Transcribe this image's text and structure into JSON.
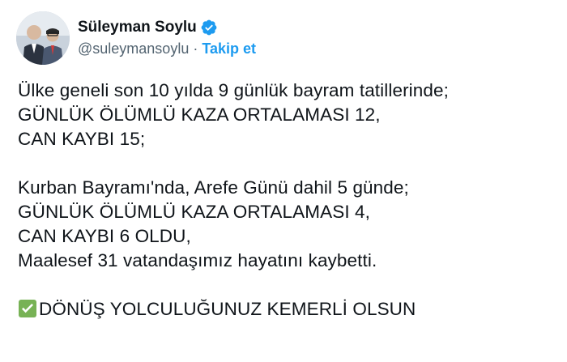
{
  "tweet": {
    "author": {
      "display_name": "Süleyman Soylu",
      "handle": "@suleymansoylu",
      "separator": "·",
      "follow_label": "Takip et",
      "verified": true,
      "verified_color": "#1d9bf0"
    },
    "lines": [
      "Ülke geneli son 10 yılda 9 günlük bayram tatillerinde;",
      "GÜNLÜK ÖLÜMLÜ KAZA ORTALAMASI 12,",
      "CAN KAYBI 15;",
      "",
      "Kurban Bayramı'nda, Arefe Günü dahil 5 günde;",
      "GÜNLÜK ÖLÜMLÜ KAZA ORTALAMASI 4,",
      "CAN KAYBI 6 OLDU,",
      "Maalesef 31 vatandaşımız hayatını kaybetti.",
      "",
      "DÖNÜŞ YOLCULUĞUNUZ KEMERLİ OLSUN"
    ],
    "last_line_emoji": "check-mark-button-icon"
  },
  "colors": {
    "text": "#0f1419",
    "muted": "#536471",
    "link": "#1d9bf0",
    "emoji_green": "#77b255"
  }
}
